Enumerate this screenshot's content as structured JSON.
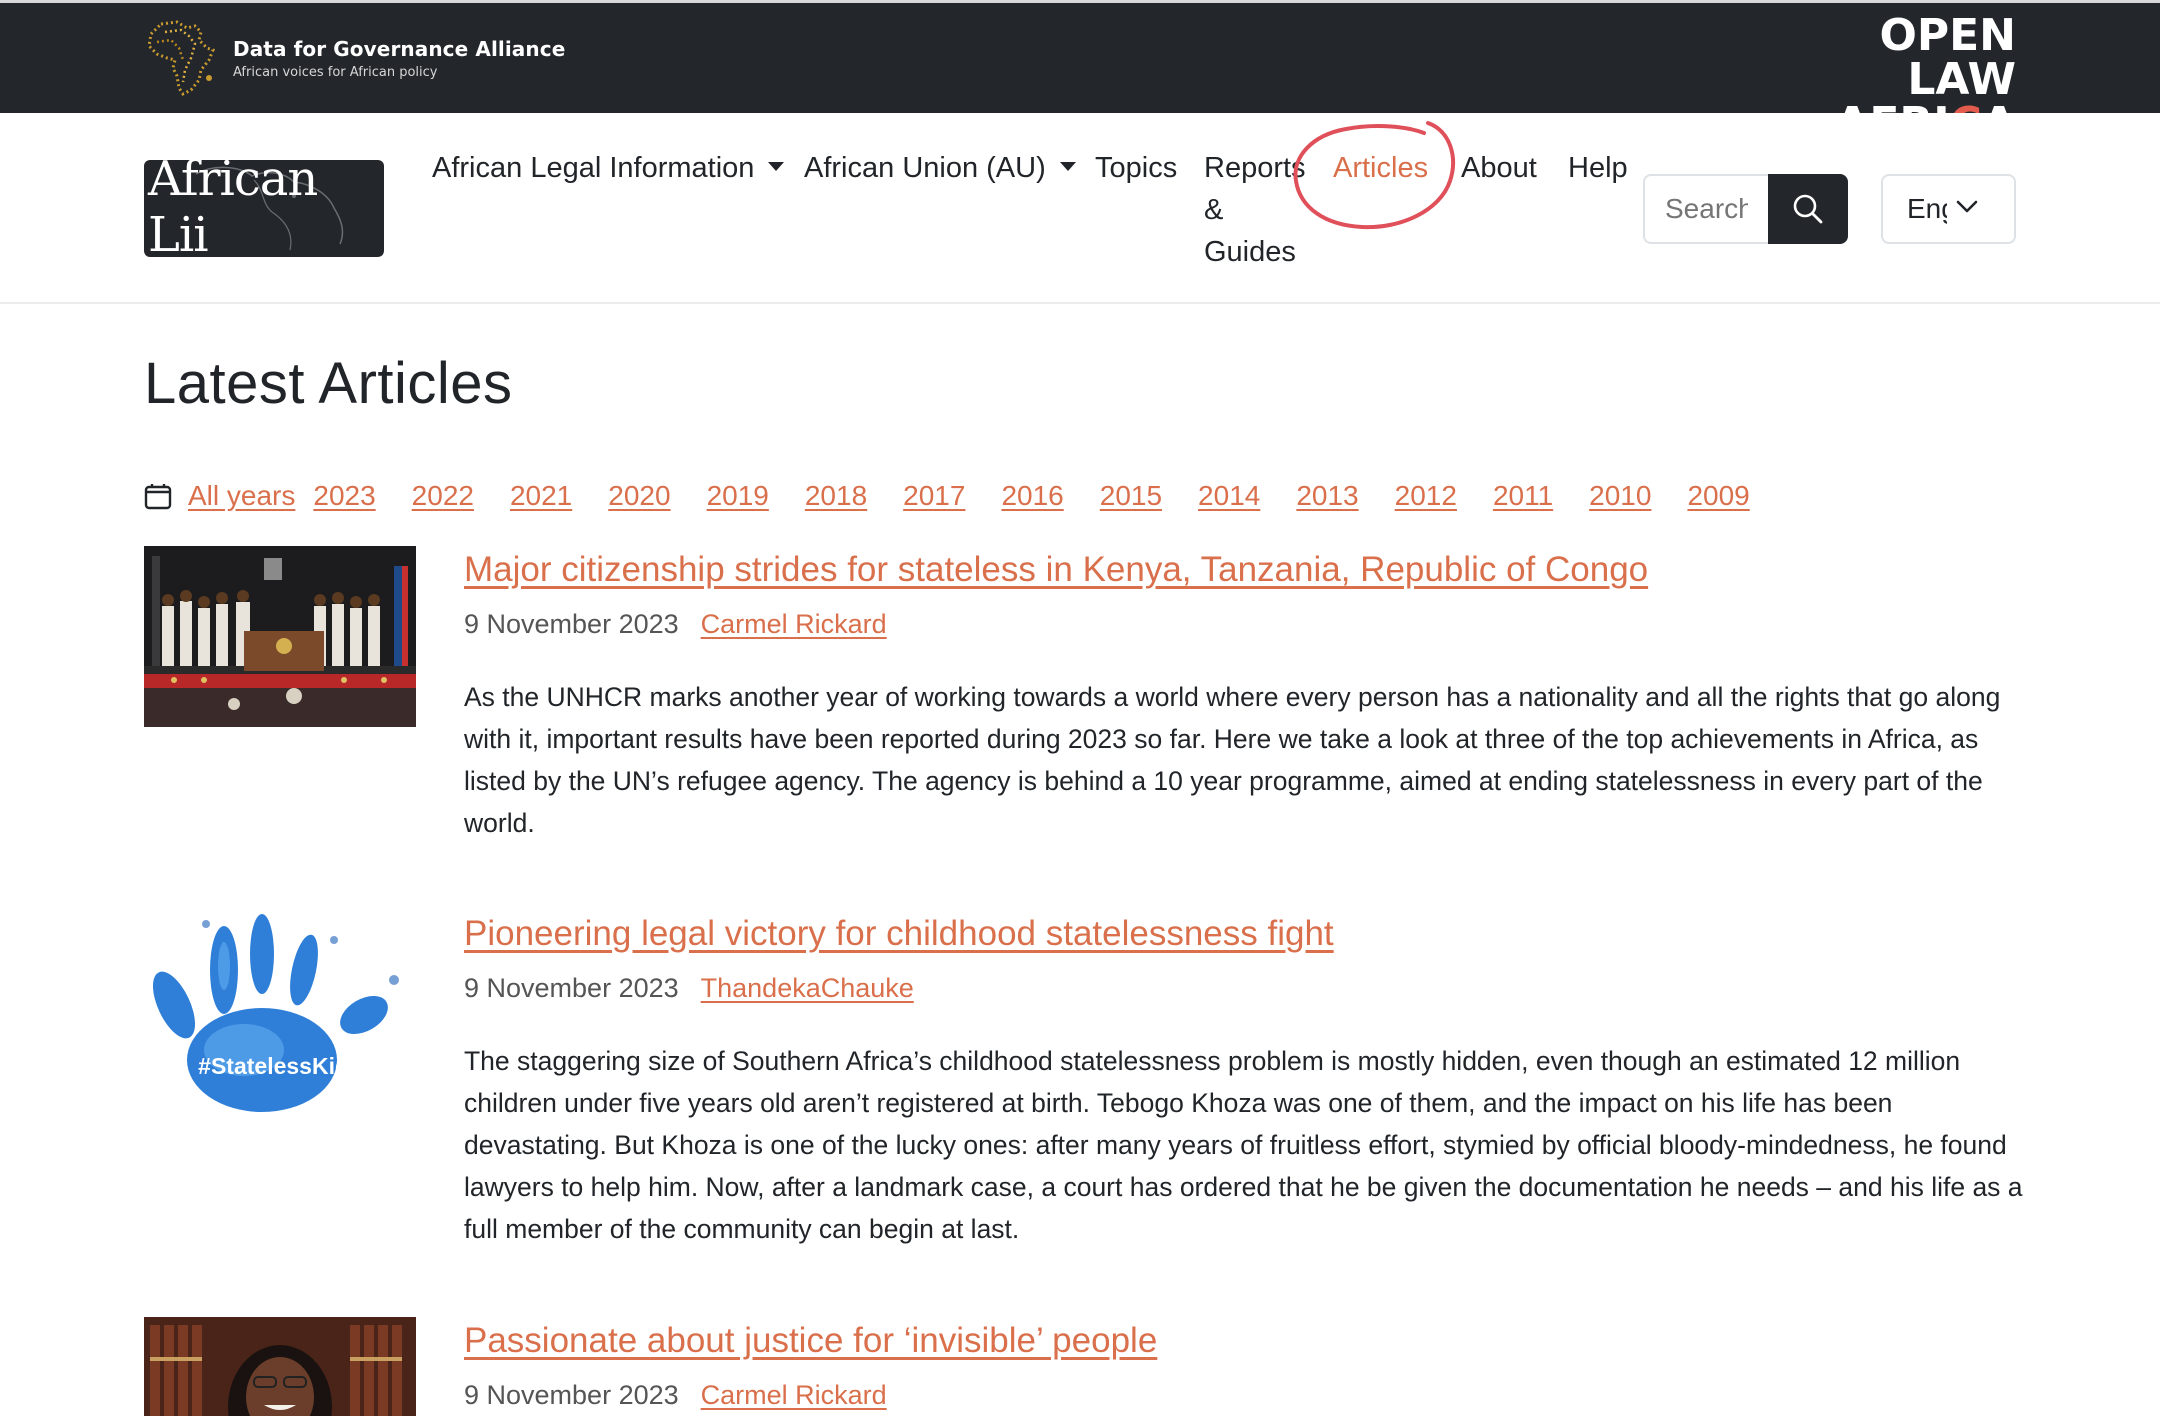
{
  "topbar": {
    "dga_title": "Data for Governance Alliance",
    "dga_subtitle": "African voices for African policy",
    "ola_line1": "OPEN LAW",
    "ola_line2_a": "AFRI",
    "ola_line2_b": "C",
    "ola_line2_c": "A"
  },
  "brand": {
    "text": "African Lii"
  },
  "nav": {
    "legal_info": "African Legal Information",
    "au": "African Union (AU)",
    "topics": "Topics",
    "reports_1": "Reports",
    "reports_2": "&",
    "reports_3": "Guides",
    "articles": "Articles",
    "about": "About",
    "help": "Help",
    "search_placeholder": "Search",
    "language": "English"
  },
  "page": {
    "title": "Latest Articles"
  },
  "years": [
    "All years",
    "2023",
    "2022",
    "2021",
    "2020",
    "2019",
    "2018",
    "2017",
    "2016",
    "2015",
    "2014",
    "2013",
    "2012",
    "2011",
    "2010",
    "2009"
  ],
  "articles": [
    {
      "title": "Major citizenship strides for stateless in Kenya, Tanzania, Republic of Congo",
      "date": "9 November 2023",
      "author": "Carmel Rickard",
      "summary": "As the UNHCR marks another year of working towards a world where every person has a nationality and all the rights that go along with it, important results have been reported during 2023 so far. Here we take a look at three of the top achievements in Africa, as listed by the UN’s refugee agency. The agency is behind a 10 year programme, aimed at ending statelessness in every part of the world."
    },
    {
      "title": "Pioneering legal victory for childhood statelessness fight",
      "date": "9 November 2023",
      "author": "ThandekaChauke",
      "summary": "The staggering size of Southern Africa’s childhood statelessness problem is mostly hidden, even though an estimated 12 million children under five years old aren’t registered at birth. Tebogo Khoza was one of them, and the impact on his life has been devastating. But Khoza is one of the lucky ones: after many years of fruitless effort, stymied by official bloody-mindedness, he found lawyers to help him. Now, after a landmark case, a court has ordered that he be given the documentation he needs – and his life as a full member of the community can begin at last.",
      "image_caption": "#StatelessKids"
    },
    {
      "title": "Passionate about justice for ‘invisible’ people",
      "date": "9 November 2023",
      "author": "Carmel Rickard"
    }
  ],
  "colors": {
    "accent": "#d96f4b",
    "dark": "#23272b",
    "annotation": "#e0505a"
  }
}
